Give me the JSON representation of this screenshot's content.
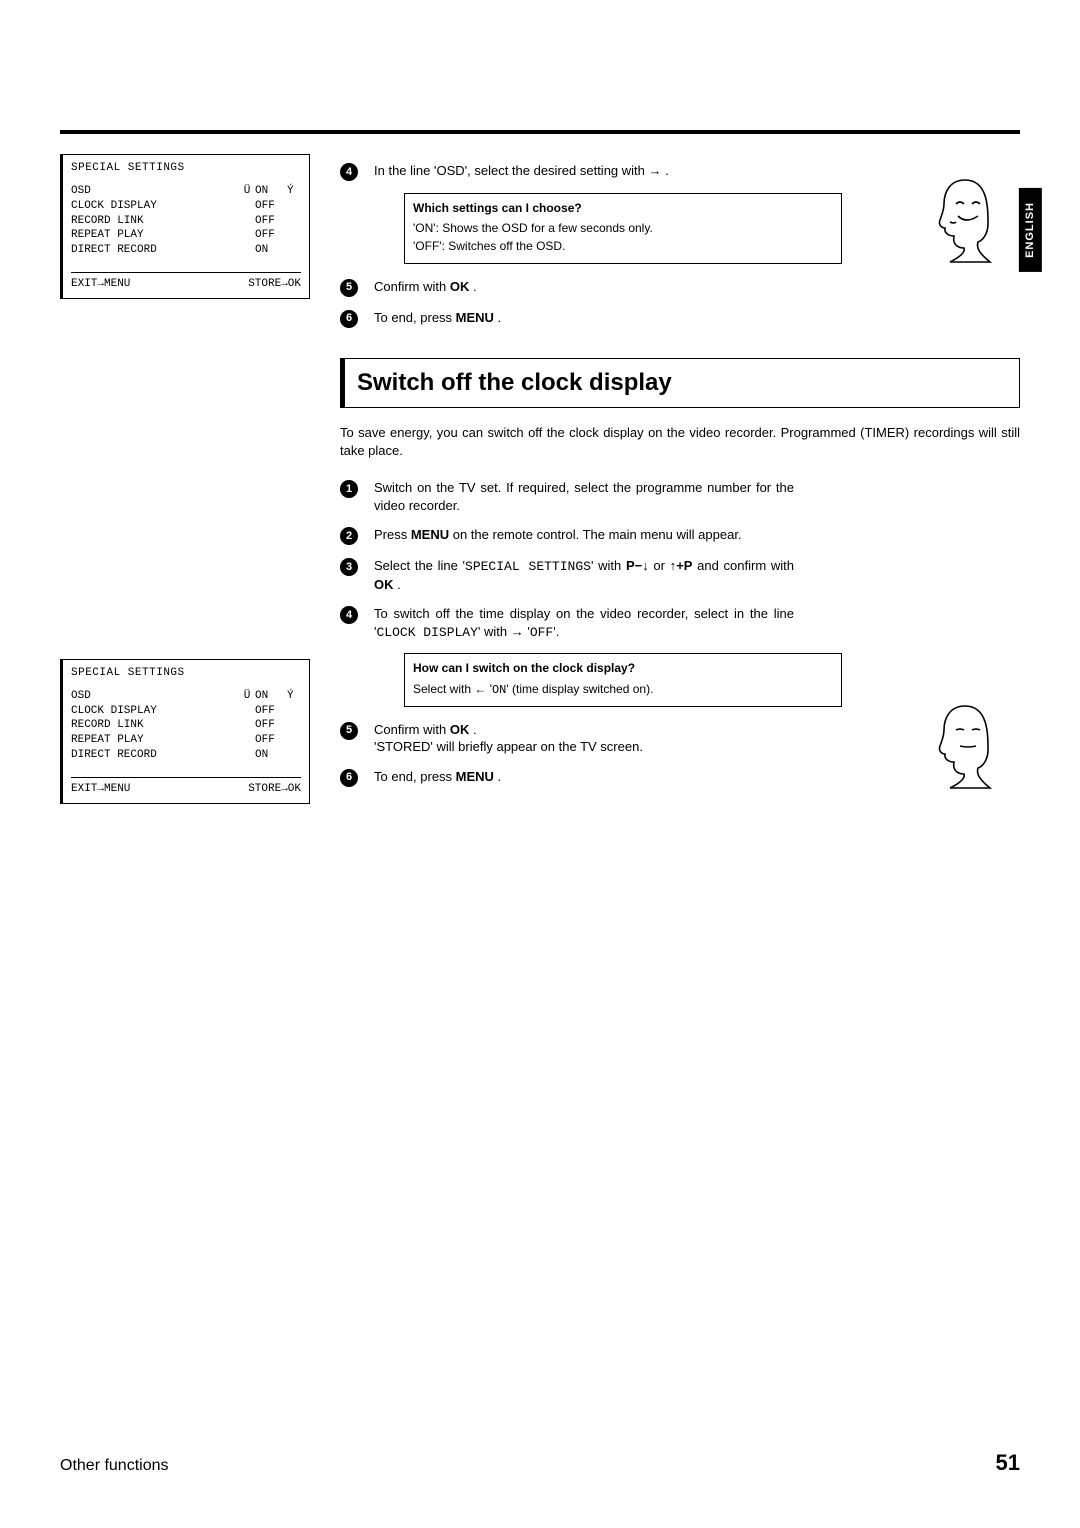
{
  "language_tab": "ENGLISH",
  "osd1": {
    "title": "SPECIAL SETTINGS",
    "rows": [
      {
        "label": "OSD",
        "left_arrow": "Ü",
        "value": "ON",
        "right_arrow": "Ý"
      },
      {
        "label": "CLOCK DISPLAY",
        "left_arrow": "",
        "value": "OFF",
        "right_arrow": ""
      },
      {
        "label": "RECORD LINK",
        "left_arrow": "",
        "value": "OFF",
        "right_arrow": ""
      },
      {
        "label": "REPEAT PLAY",
        "left_arrow": "",
        "value": "OFF",
        "right_arrow": ""
      },
      {
        "label": "DIRECT RECORD",
        "left_arrow": "",
        "value": "ON",
        "right_arrow": ""
      }
    ],
    "footer_left": "EXIT→MENU",
    "footer_right": "STORE→OK"
  },
  "osd2": {
    "title": "SPECIAL SETTINGS",
    "rows": [
      {
        "label": "OSD",
        "left_arrow": "Ü",
        "value": "ON",
        "right_arrow": "Ý"
      },
      {
        "label": "CLOCK DISPLAY",
        "left_arrow": "",
        "value": "OFF",
        "right_arrow": ""
      },
      {
        "label": "RECORD LINK",
        "left_arrow": "",
        "value": "OFF",
        "right_arrow": ""
      },
      {
        "label": "REPEAT PLAY",
        "left_arrow": "",
        "value": "OFF",
        "right_arrow": ""
      },
      {
        "label": "DIRECT RECORD",
        "left_arrow": "",
        "value": "ON",
        "right_arrow": ""
      }
    ],
    "footer_left": "EXIT→MENU",
    "footer_right": "STORE→OK"
  },
  "section1": {
    "steps": {
      "s4": "In the line 'OSD', select the desired setting with → .",
      "s5": "Confirm with OK .",
      "s6": "To end, press MENU ."
    },
    "callout": {
      "title": "Which settings can I choose?",
      "lines": [
        "'ON': Shows the OSD for a few seconds only.",
        "'OFF': Switches off the OSD."
      ]
    }
  },
  "heading": "Switch off the clock display",
  "intro": "To save energy, you can switch off the clock display on the video recorder. Programmed (TIMER) recordings will still take place.",
  "section2": {
    "steps": {
      "s1": "Switch on the TV set. If required, select the programme number for the video recorder.",
      "s2_a": "Press ",
      "s2_b": "MENU",
      "s2_c": " on the remote control. The main menu will appear.",
      "s3_a": "Select the line '",
      "s3_b": "SPECIAL SETTINGS",
      "s3_c": "' with ",
      "s3_d": "P−↓",
      "s3_e": " or ",
      "s3_f": "↑+P",
      "s3_g": " and confirm with ",
      "s3_h": "OK",
      "s3_i": " .",
      "s4_a": "To switch off the time display on the video recorder, select in the line '",
      "s4_b": "CLOCK DISPLAY",
      "s4_c": "' with → '",
      "s4_d": "OFF",
      "s4_e": "'.",
      "s5_a": "Confirm with ",
      "s5_b": "OK",
      "s5_c": " .",
      "s5_d": "'STORED' will briefly appear on the TV screen.",
      "s6_a": "To end, press ",
      "s6_b": "MENU",
      "s6_c": " ."
    },
    "callout": {
      "title": "How can I switch on the clock display?",
      "line_a": "Select with ← '",
      "line_b": "ON",
      "line_c": "' (time display switched on)."
    }
  },
  "footer": {
    "section": "Other functions",
    "page": "51"
  }
}
